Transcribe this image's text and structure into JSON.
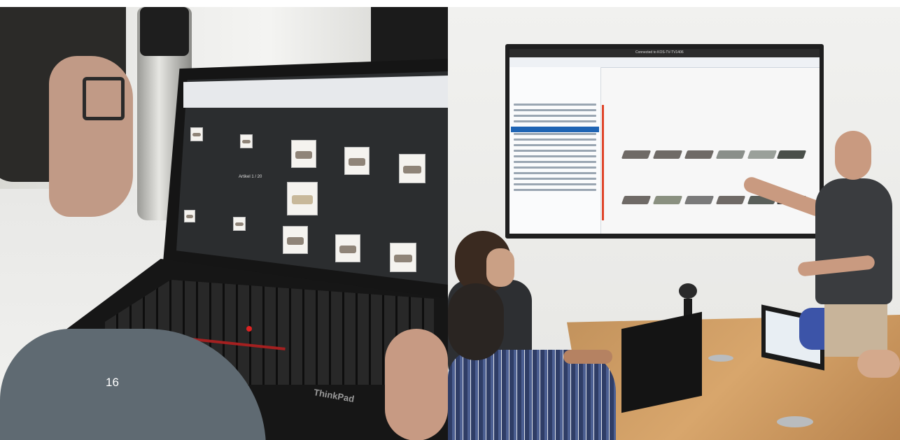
{
  "page": {
    "number_label": "16"
  },
  "left_photo": {
    "description_icon": "laptop-photo",
    "laptop_brand": "ThinkPad",
    "screen": {
      "heading": "Artikel 1 / 20"
    }
  },
  "right_photo": {
    "description_icon": "meeting-room-photo",
    "tv_title": "Connected to KOS-TV-TV1406"
  },
  "colors": {
    "background": "#ffffff",
    "laptop_red": "#d22222",
    "notebook_accent": "#e0452a",
    "file_highlight": "#1e64b4"
  }
}
